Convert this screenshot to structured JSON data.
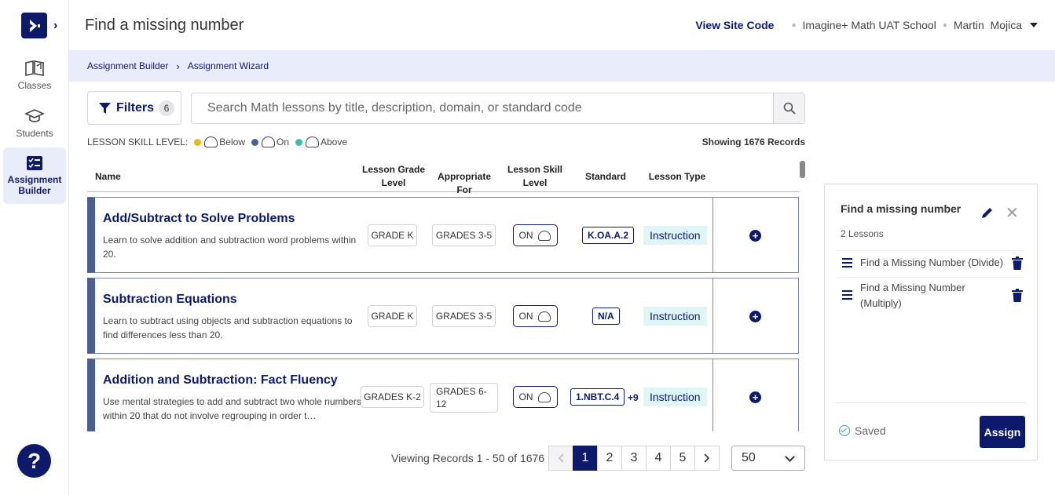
{
  "sidebar": {
    "items": [
      {
        "label": "Classes"
      },
      {
        "label": "Students"
      },
      {
        "label": "Assignment Builder"
      }
    ],
    "help": "?"
  },
  "header": {
    "title": "Find a missing number",
    "site_code": "View Site Code",
    "school": "Imagine+ Math UAT School",
    "user": "Martin  Mojica"
  },
  "breadcrumb": [
    "Assignment Builder",
    "Assignment Wizard"
  ],
  "filters": {
    "label": "Filters",
    "count": "6"
  },
  "search": {
    "placeholder": "Search Math lessons by title, description, domain, or standard code"
  },
  "skill_legend": {
    "label": "LESSON SKILL LEVEL:",
    "below": "Below",
    "on": "On",
    "above": "Above",
    "colors": {
      "below": "#f2b418",
      "on": "#4a5f9a",
      "above": "#3cbfa8"
    }
  },
  "showing": "Showing 1676 Records",
  "table": {
    "headers": {
      "name": "Name",
      "grade": "Lesson Grade Level",
      "appropriate": "Appropriate For",
      "skill": "Lesson Skill Level",
      "standard": "Standard",
      "type": "Lesson Type"
    },
    "rows": [
      {
        "title": "Add/Subtract to Solve Problems",
        "desc": "Learn to solve addition and subtraction word problems within 20.",
        "grade": "GRADE K",
        "appropriate": "GRADES 3-5",
        "skill": "ON",
        "standard": "K.OA.A.2",
        "more": "",
        "type": "Instruction"
      },
      {
        "title": "Subtraction Equations",
        "desc": "Learn to subtract using objects and subtraction equations to find differences less than 20.",
        "grade": "GRADE K",
        "appropriate": "GRADES 3-5",
        "skill": "ON",
        "standard": "N/A",
        "more": "",
        "type": "Instruction"
      },
      {
        "title": "Addition and Subtraction: Fact Fluency",
        "desc": "Use mental strategies to add and subtract two whole numbers within 20 that do not involve regrouping in order t…",
        "grade": "GRADES K-2",
        "appropriate": "GRADES 6-12",
        "skill": "ON",
        "standard": "1.NBT.C.4",
        "more": "+9",
        "type": "Instruction"
      }
    ]
  },
  "pagination": {
    "viewing": "Viewing Records 1 - 50 of 1676",
    "pages": [
      "1",
      "2",
      "3",
      "4",
      "5"
    ],
    "per_page": "50"
  },
  "panel": {
    "title": "Find a missing number",
    "subtitle": "2 Lessons",
    "items": [
      {
        "label": "Find a Missing Number (Divide)"
      },
      {
        "label": "Find a Missing Number (Multiply)"
      }
    ],
    "saved": "Saved",
    "assign": "Assign"
  }
}
